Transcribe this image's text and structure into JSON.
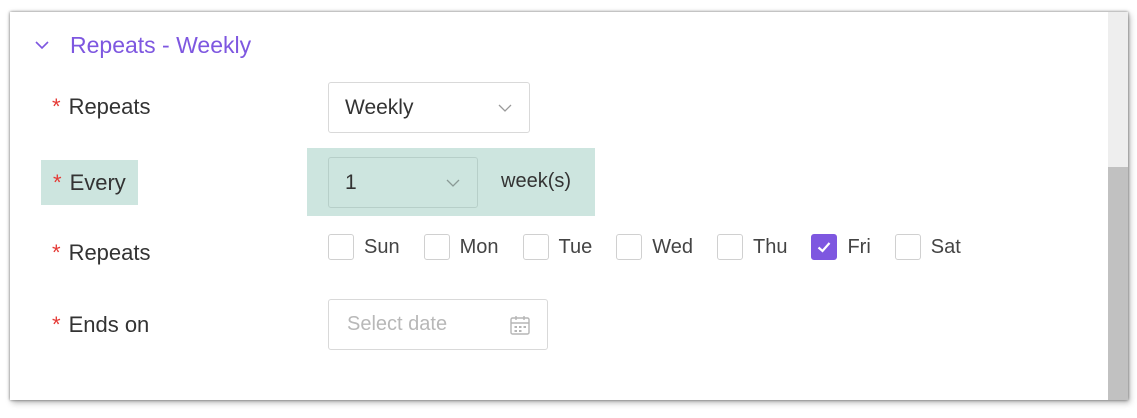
{
  "section": {
    "title": "Repeats - Weekly",
    "icon": "chevron-down-icon"
  },
  "rows": {
    "repeats": {
      "required_mark": "*",
      "label": "Repeats",
      "value": "Weekly"
    },
    "every": {
      "required_mark": "*",
      "label": "Every",
      "value": "1",
      "unit": "week(s)",
      "highlight_color": "#cde5df"
    },
    "weekdays": {
      "required_mark": "*",
      "label": "Repeats",
      "days": [
        {
          "label": "Sun",
          "checked": false
        },
        {
          "label": "Mon",
          "checked": false
        },
        {
          "label": "Tue",
          "checked": false
        },
        {
          "label": "Wed",
          "checked": false
        },
        {
          "label": "Thu",
          "checked": false
        },
        {
          "label": "Fri",
          "checked": true
        },
        {
          "label": "Sat",
          "checked": false
        }
      ]
    },
    "ends_on": {
      "required_mark": "*",
      "label": "Ends on",
      "placeholder": "Select date",
      "value": "",
      "icon": "calendar-icon"
    }
  },
  "colors": {
    "accent": "#7e57e0",
    "required": "#e53935",
    "highlight": "#cde5df"
  }
}
